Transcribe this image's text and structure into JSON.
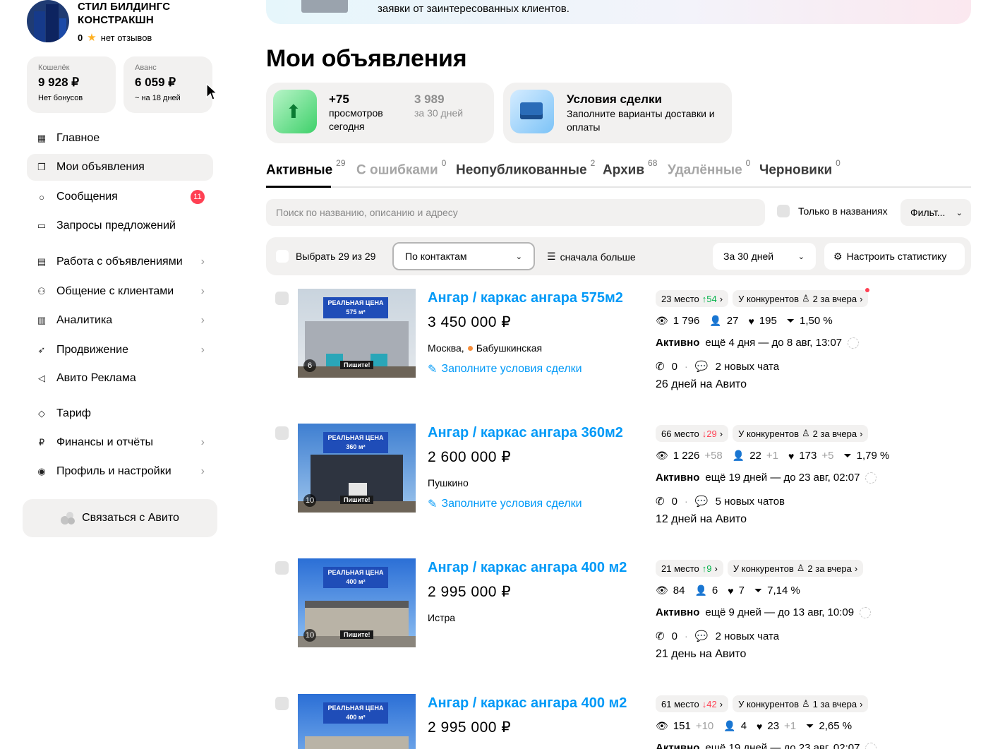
{
  "company": {
    "name_line1": "СТИЛ БИЛДИНГС",
    "name_line2": "КОНСТРАКШН",
    "rating": "0",
    "reviews": "нет отзывов"
  },
  "wallets": [
    {
      "label": "Кошелёк",
      "value": "9 928 ₽",
      "sub": "Нет бонусов"
    },
    {
      "label": "Аванс",
      "value": "6 059 ₽",
      "sub": "~ на 18 дней"
    }
  ],
  "nav": [
    {
      "label": "Главное",
      "icon": "grid-icon"
    },
    {
      "label": "Мои объявления",
      "icon": "copy-icon"
    },
    {
      "label": "Сообщения",
      "icon": "chat-icon",
      "badge": "11"
    },
    {
      "label": "Запросы предложений",
      "icon": "folder-icon"
    },
    {
      "label": "Работа с объявлениями",
      "icon": "doc-icon"
    },
    {
      "label": "Общение с клиентами",
      "icon": "people-icon"
    },
    {
      "label": "Аналитика",
      "icon": "bar-chart-icon"
    },
    {
      "label": "Продвижение",
      "icon": "rocket-icon"
    },
    {
      "label": "Авито Реклама",
      "icon": "megaphone-icon"
    },
    {
      "label": "Тариф",
      "icon": "diamond-icon"
    },
    {
      "label": "Финансы и отчёты",
      "icon": "ruble-icon"
    },
    {
      "label": "Профиль и настройки",
      "icon": "user-circle-icon"
    }
  ],
  "contact_button": "Связаться с Авито",
  "banner_text": "заявки от заинтересованных клиентов.",
  "page_title": "Мои объявления",
  "views_card": {
    "today_value": "+75",
    "today_label_1": "просмотров",
    "today_label_2": "сегодня",
    "month_value": "3 989",
    "month_label": "за 30 дней"
  },
  "deal_card": {
    "title": "Условия сделки",
    "text_1": "Заполните варианты доставки и",
    "text_2": "оплаты"
  },
  "tabs": [
    {
      "label": "Активные",
      "count": "29"
    },
    {
      "label": "С ошибками",
      "count": "0"
    },
    {
      "label": "Неопубликованные",
      "count": "2"
    },
    {
      "label": "Архив",
      "count": "68"
    },
    {
      "label": "Удалённые",
      "count": "0"
    },
    {
      "label": "Черновики",
      "count": "0"
    }
  ],
  "search": {
    "placeholder": "Поиск по названию, описанию и адресу",
    "only_titles": "Только в названиях",
    "filter": "Фильт..."
  },
  "toolbar": {
    "select_all": "Выбрать 29 из 29",
    "sort_by": "По контактам",
    "sort_order": "сначала больше",
    "period": "За 30 дней",
    "settings": "Настроить статистику"
  },
  "listings": [
    {
      "title": "Ангар / каркас ангара 575м2",
      "price": "3 450 000 ₽",
      "city": "Москва,",
      "metro": "Бабушкинская",
      "deal_link": "Заполните условия сделки",
      "photo_count": "6",
      "thumb_label_1": "РЕАЛЬНАЯ ЦЕНА",
      "thumb_label_2": "575 м²",
      "thumb_write": "Пишите!",
      "place": "23 место",
      "place_delta": "↑54",
      "competitors": "У конкурентов",
      "competitors_count": "2 за вчера",
      "views": "1 796",
      "views_delta": "",
      "contacts": "27",
      "contacts_delta": "",
      "favs": "195",
      "favs_delta": "",
      "conversion": "1,50 %",
      "active_label": "Активно",
      "active_text": "ещё 4 дня — до 8 авг, 13:07",
      "calls": "0",
      "chats": "2 новых чата",
      "on_avito": "26 дней на Авито"
    },
    {
      "title": "Ангар / каркас ангара 360м2",
      "price": "2 600 000 ₽",
      "city": "Пушкино",
      "metro": "",
      "deal_link": "Заполните условия сделки",
      "photo_count": "10",
      "thumb_label_1": "РЕАЛЬНАЯ ЦЕНА",
      "thumb_label_2": "360 м²",
      "thumb_write": "Пишите!",
      "place": "66 место",
      "place_delta": "↓29",
      "competitors": "У конкурентов",
      "competitors_count": "2 за вчера",
      "views": "1 226",
      "views_delta": "+58",
      "contacts": "22",
      "contacts_delta": "+1",
      "favs": "173",
      "favs_delta": "+5",
      "conversion": "1,79 %",
      "active_label": "Активно",
      "active_text": "ещё 19 дней — до 23 авг, 02:07",
      "calls": "0",
      "chats": "5 новых чатов",
      "on_avito": "12 дней на Авито"
    },
    {
      "title": "Ангар / каркас ангара 400 м2",
      "price": "2 995 000 ₽",
      "city": "Истра",
      "metro": "",
      "deal_link": "",
      "photo_count": "10",
      "thumb_label_1": "РЕАЛЬНАЯ ЦЕНА",
      "thumb_label_2": "400 м²",
      "thumb_write": "Пишите!",
      "place": "21 место",
      "place_delta": "↑9",
      "competitors": "У конкурентов",
      "competitors_count": "2 за вчера",
      "views": "84",
      "views_delta": "",
      "contacts": "6",
      "contacts_delta": "",
      "favs": "7",
      "favs_delta": "",
      "conversion": "7,14 %",
      "active_label": "Активно",
      "active_text": "ещё 9 дней — до 13 авг, 10:09",
      "calls": "0",
      "chats": "2 новых чата",
      "on_avito": "21 день на Авито"
    },
    {
      "title": "Ангар / каркас ангара 400 м2",
      "price": "2 995 000 ₽",
      "city": "",
      "metro": "",
      "deal_link": "",
      "photo_count": "",
      "thumb_label_1": "РЕАЛЬНАЯ ЦЕНА",
      "thumb_label_2": "400 м²",
      "thumb_write": "",
      "place": "61 место",
      "place_delta": "↓42",
      "competitors": "У конкурентов",
      "competitors_count": "1 за вчера",
      "views": "151",
      "views_delta": "+10",
      "contacts": "4",
      "contacts_delta": "",
      "favs": "23",
      "favs_delta": "+1",
      "conversion": "2,65 %",
      "active_label": "Активно",
      "active_text": "ещё 19 дней — до 23 авг, 02:07",
      "calls": "",
      "chats": "",
      "on_avito": ""
    }
  ],
  "colors": {
    "accent_blue": "#0099f7",
    "badge_red": "#ff4053",
    "up_green": "#04b34a",
    "card_bg": "#f2f1f0"
  }
}
